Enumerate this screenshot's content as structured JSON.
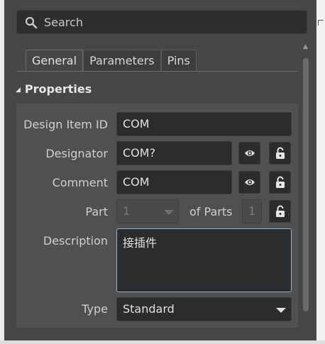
{
  "search": {
    "placeholder": "Search",
    "icon": "search-icon"
  },
  "tabs": [
    {
      "label": "General",
      "active": true
    },
    {
      "label": "Parameters",
      "active": false
    },
    {
      "label": "Pins",
      "active": false
    }
  ],
  "section": {
    "title": "Properties",
    "expanded": true
  },
  "fields": {
    "design_item_id": {
      "label": "Design Item ID",
      "value": "COM"
    },
    "designator": {
      "label": "Designator",
      "value": "COM?"
    },
    "comment": {
      "label": "Comment",
      "value": "COM"
    },
    "part": {
      "label": "Part",
      "value": "1",
      "of_parts_label": "of Parts",
      "of_parts_value": "1"
    },
    "description": {
      "label": "Description",
      "value": "接插件"
    },
    "type": {
      "label": "Type",
      "value": "Standard"
    }
  },
  "icons": {
    "visibility": "eye-icon",
    "lock": "lock-icon"
  },
  "colors": {
    "panel": "#474747",
    "field": "#2c2c2c",
    "focus_border": "#8fb3d9"
  }
}
